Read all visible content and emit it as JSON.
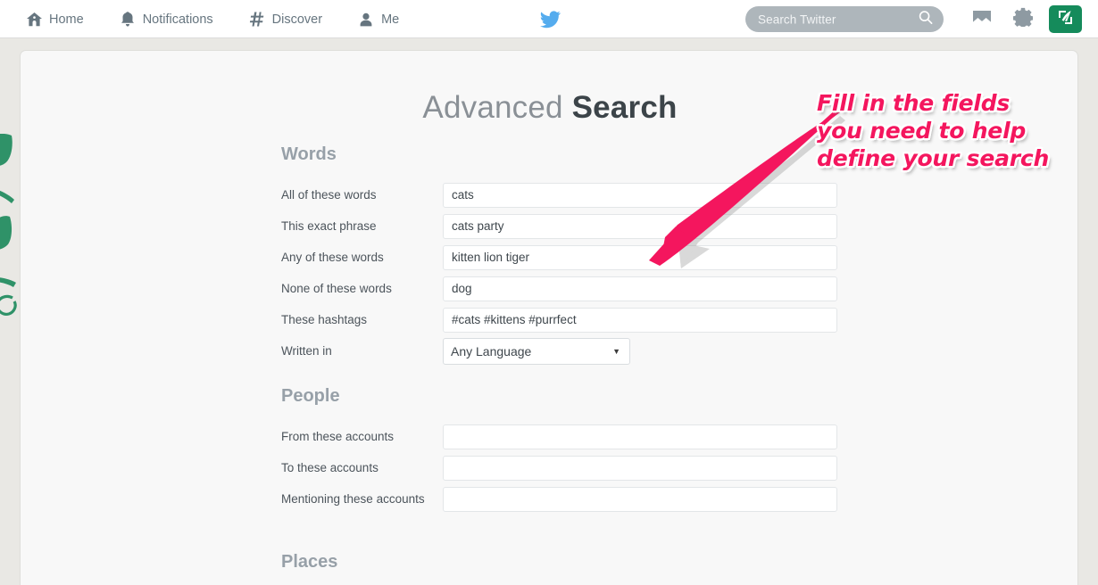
{
  "theme": {
    "accent_green": "#158b5b",
    "twitter_blue": "#55acee",
    "annotation_pink": "#f4165e",
    "nav_text": "#66757f",
    "heading_gray": "#97a0a8",
    "page_bg": "#e9e8e4",
    "panel_bg": "#f8f8f8"
  },
  "nav": {
    "items": [
      {
        "label": "Home",
        "icon": "home-icon"
      },
      {
        "label": "Notifications",
        "icon": "bell-icon"
      },
      {
        "label": "Discover",
        "icon": "hashtag-icon"
      },
      {
        "label": "Me",
        "icon": "person-icon"
      }
    ],
    "logo": "twitter-bird-icon",
    "search": {
      "placeholder": "Search Twitter",
      "value": "",
      "icon": "search-icon"
    },
    "messages_icon": "envelope-icon",
    "settings_icon": "gear-icon",
    "compose_icon": "compose-tweet-icon"
  },
  "page": {
    "title_light": "Advanced",
    "title_bold": "Search"
  },
  "sections": [
    {
      "heading": "Words",
      "rows": [
        {
          "label": "All of these words",
          "type": "text",
          "value": "cats",
          "placeholder": ""
        },
        {
          "label": "This exact phrase",
          "type": "text",
          "value": "cats party",
          "placeholder": ""
        },
        {
          "label": "Any of these words",
          "type": "text",
          "value": "kitten lion tiger",
          "placeholder": ""
        },
        {
          "label": "None of these words",
          "type": "text",
          "value": "dog",
          "placeholder": ""
        },
        {
          "label": "These hashtags",
          "type": "text",
          "value": "#cats #kittens #purrfect",
          "placeholder": ""
        },
        {
          "label": "Written in",
          "type": "select",
          "value": "Any Language",
          "options": [
            "Any Language"
          ]
        }
      ]
    },
    {
      "heading": "People",
      "rows": [
        {
          "label": "From these accounts",
          "type": "text",
          "value": "",
          "placeholder": ""
        },
        {
          "label": "To these accounts",
          "type": "text",
          "value": "",
          "placeholder": ""
        },
        {
          "label": "Mentioning these accounts",
          "type": "text",
          "value": "",
          "placeholder": ""
        }
      ]
    },
    {
      "heading": "Places",
      "rows": []
    }
  ],
  "annotation": {
    "line1": "Fill in the fields",
    "line2": "you need to help",
    "line3": "define your search",
    "arrow": "arrow-pointing-down-left"
  }
}
